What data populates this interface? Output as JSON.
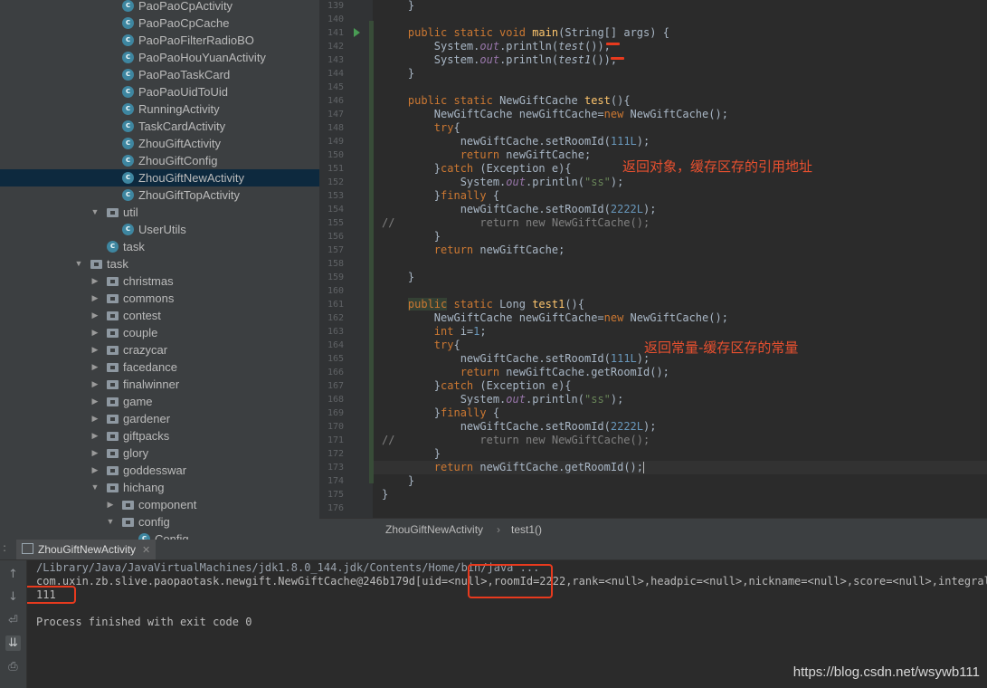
{
  "tree": {
    "items": [
      {
        "label": "PaoPaoCpActivity",
        "icon": "class-icon",
        "indent": 2
      },
      {
        "label": "PaoPaoCpCache",
        "icon": "class-icon",
        "indent": 2
      },
      {
        "label": "PaoPaoFilterRadioBO",
        "icon": "class-icon",
        "indent": 2
      },
      {
        "label": "PaoPaoHouYuanActivity",
        "icon": "class-icon",
        "indent": 2
      },
      {
        "label": "PaoPaoTaskCard",
        "icon": "class-icon",
        "indent": 2
      },
      {
        "label": "PaoPaoUidToUid",
        "icon": "class-icon",
        "indent": 2
      },
      {
        "label": "RunningActivity",
        "icon": "class-icon",
        "indent": 2
      },
      {
        "label": "TaskCardActivity",
        "icon": "class-icon",
        "indent": 2
      },
      {
        "label": "ZhouGiftActivity",
        "icon": "class-icon",
        "indent": 2
      },
      {
        "label": "ZhouGiftConfig",
        "icon": "class-icon",
        "indent": 2
      },
      {
        "label": "ZhouGiftNewActivity",
        "icon": "class-icon",
        "indent": 2,
        "selected": true
      },
      {
        "label": "ZhouGiftTopActivity",
        "icon": "class-icon",
        "indent": 2
      },
      {
        "label": "util",
        "icon": "folder-icon",
        "indent": 1,
        "expanded": true
      },
      {
        "label": "UserUtils",
        "icon": "class-icon",
        "indent": 2
      },
      {
        "label": "task",
        "icon": "class-icon",
        "indent": 1
      },
      {
        "label": "task",
        "icon": "folder-icon",
        "indent": 0,
        "expanded": true
      },
      {
        "label": "christmas",
        "icon": "folder-icon",
        "indent": 1,
        "expanded": false
      },
      {
        "label": "commons",
        "icon": "folder-icon",
        "indent": 1,
        "expanded": false
      },
      {
        "label": "contest",
        "icon": "folder-icon",
        "indent": 1,
        "expanded": false
      },
      {
        "label": "couple",
        "icon": "folder-icon",
        "indent": 1,
        "expanded": false
      },
      {
        "label": "crazycar",
        "icon": "folder-icon",
        "indent": 1,
        "expanded": false
      },
      {
        "label": "facedance",
        "icon": "folder-icon",
        "indent": 1,
        "expanded": false
      },
      {
        "label": "finalwinner",
        "icon": "folder-icon",
        "indent": 1,
        "expanded": false
      },
      {
        "label": "game",
        "icon": "folder-icon",
        "indent": 1,
        "expanded": false
      },
      {
        "label": "gardener",
        "icon": "folder-icon",
        "indent": 1,
        "expanded": false
      },
      {
        "label": "giftpacks",
        "icon": "folder-icon",
        "indent": 1,
        "expanded": false
      },
      {
        "label": "glory",
        "icon": "folder-icon",
        "indent": 1,
        "expanded": false
      },
      {
        "label": "goddesswar",
        "icon": "folder-icon",
        "indent": 1,
        "expanded": false
      },
      {
        "label": "hichang",
        "icon": "folder-icon",
        "indent": 1,
        "expanded": true
      },
      {
        "label": "component",
        "icon": "folder-icon",
        "indent": 2,
        "expanded": false
      },
      {
        "label": "config",
        "icon": "folder-icon",
        "indent": 2,
        "expanded": true
      },
      {
        "label": "Config",
        "icon": "class-icon",
        "indent": 3
      }
    ]
  },
  "editor": {
    "line_numbers": [
      "139",
      "140",
      "141",
      "142",
      "143",
      "144",
      "145",
      "146",
      "147",
      "148",
      "149",
      "150",
      "151",
      "152",
      "153",
      "154",
      "155",
      "156",
      "157",
      "158",
      "159",
      "160",
      "161",
      "162",
      "163",
      "164",
      "165",
      "166",
      "167",
      "168",
      "169",
      "170",
      "171",
      "172",
      "173",
      "174",
      "175",
      "176"
    ],
    "code": [
      [
        {
          "t": "    }"
        }
      ],
      [],
      [
        {
          "t": "    "
        },
        {
          "t": "public static void ",
          "c": "kw"
        },
        {
          "t": "main",
          "c": "fn"
        },
        {
          "t": "(String[] args) {"
        }
      ],
      [
        {
          "t": "        System."
        },
        {
          "t": "out",
          "c": "fld"
        },
        {
          "t": ".println("
        },
        {
          "t": "test",
          "c": "it"
        },
        {
          "t": "());"
        }
      ],
      [
        {
          "t": "        System."
        },
        {
          "t": "out",
          "c": "fld"
        },
        {
          "t": ".println("
        },
        {
          "t": "test1",
          "c": "it"
        },
        {
          "t": "());"
        }
      ],
      [
        {
          "t": "    }"
        }
      ],
      [],
      [
        {
          "t": "    "
        },
        {
          "t": "public static ",
          "c": "kw"
        },
        {
          "t": "NewGiftCache "
        },
        {
          "t": "test",
          "c": "fn"
        },
        {
          "t": "(){"
        }
      ],
      [
        {
          "t": "        NewGiftCache newGiftCache="
        },
        {
          "t": "new ",
          "c": "kw"
        },
        {
          "t": "NewGiftCache();"
        }
      ],
      [
        {
          "t": "        "
        },
        {
          "t": "try",
          "c": "kw"
        },
        {
          "t": "{"
        }
      ],
      [
        {
          "t": "            newGiftCache.setRoomId("
        },
        {
          "t": "111L",
          "c": "num"
        },
        {
          "t": ");"
        }
      ],
      [
        {
          "t": "            "
        },
        {
          "t": "return ",
          "c": "kw"
        },
        {
          "t": "newGiftCache;"
        }
      ],
      [
        {
          "t": "        }"
        },
        {
          "t": "catch ",
          "c": "kw"
        },
        {
          "t": "(Exception e){"
        }
      ],
      [
        {
          "t": "            System."
        },
        {
          "t": "out",
          "c": "fld"
        },
        {
          "t": ".println("
        },
        {
          "t": "\"ss\"",
          "c": "str"
        },
        {
          "t": ");"
        }
      ],
      [
        {
          "t": "        }"
        },
        {
          "t": "finally ",
          "c": "kw"
        },
        {
          "t": "{"
        }
      ],
      [
        {
          "t": "            newGiftCache.setRoomId("
        },
        {
          "t": "2222L",
          "c": "num"
        },
        {
          "t": ");"
        }
      ],
      [
        {
          "t": "//             return new NewGiftCache();",
          "c": "cmt"
        }
      ],
      [
        {
          "t": "        }"
        }
      ],
      [
        {
          "t": "        "
        },
        {
          "t": "return ",
          "c": "kw"
        },
        {
          "t": "newGiftCache;"
        }
      ],
      [],
      [
        {
          "t": "    }"
        }
      ],
      [],
      [
        {
          "t": "    "
        },
        {
          "t": "public",
          "c": "pubhl"
        },
        {
          "t": " static ",
          "c": "kw"
        },
        {
          "t": "Long "
        },
        {
          "t": "test1",
          "c": "fn"
        },
        {
          "t": "(){"
        }
      ],
      [
        {
          "t": "        NewGiftCache newGiftCache="
        },
        {
          "t": "new ",
          "c": "kw"
        },
        {
          "t": "NewGiftCache();"
        }
      ],
      [
        {
          "t": "        "
        },
        {
          "t": "int ",
          "c": "kw"
        },
        {
          "t": "i="
        },
        {
          "t": "1",
          "c": "num"
        },
        {
          "t": ";"
        }
      ],
      [
        {
          "t": "        "
        },
        {
          "t": "try",
          "c": "kw"
        },
        {
          "t": "{"
        }
      ],
      [
        {
          "t": "            newGiftCache.setRoomId("
        },
        {
          "t": "111L",
          "c": "num"
        },
        {
          "t": ");"
        }
      ],
      [
        {
          "t": "            "
        },
        {
          "t": "return ",
          "c": "kw"
        },
        {
          "t": "newGiftCache.getRoomId();"
        }
      ],
      [
        {
          "t": "        }"
        },
        {
          "t": "catch ",
          "c": "kw"
        },
        {
          "t": "(Exception e){"
        }
      ],
      [
        {
          "t": "            System."
        },
        {
          "t": "out",
          "c": "fld"
        },
        {
          "t": ".println("
        },
        {
          "t": "\"ss\"",
          "c": "str"
        },
        {
          "t": ");"
        }
      ],
      [
        {
          "t": "        }"
        },
        {
          "t": "finally ",
          "c": "kw"
        },
        {
          "t": "{"
        }
      ],
      [
        {
          "t": "            newGiftCache.setRoomId("
        },
        {
          "t": "2222L",
          "c": "num"
        },
        {
          "t": ");"
        }
      ],
      [
        {
          "t": "//             return new NewGiftCache();",
          "c": "cmt"
        }
      ],
      [
        {
          "t": "        }"
        }
      ],
      [
        {
          "t": "        "
        },
        {
          "t": "return ",
          "c": "kw"
        },
        {
          "t": "newGiftCache.getRoomId();"
        },
        {
          "caret": true
        }
      ],
      [
        {
          "t": "    }"
        }
      ],
      [
        {
          "t": "}"
        }
      ],
      []
    ],
    "annotation_1": "返回对象，缓存区存的引用地址",
    "annotation_2": "返回常量-缓存区存的常量"
  },
  "breadcrumb": [
    "ZhouGiftNewActivity",
    "test1()"
  ],
  "run_panel": {
    "tab_label": "ZhouGiftNewActivity",
    "lines": [
      "/Library/Java/JavaVirtualMachines/jdk1.8.0_144.jdk/Contents/Home/bin/java ...",
      "com.uxin.zb.slive.paopaotask.newgift.NewGiftCache@246b179d[uid=<null>,roomId=2222,rank=<null>,headpic=<null>,nickname=<null>,score=<null>,integral=<nu",
      "111",
      "",
      "Process finished with exit code 0"
    ]
  },
  "watermark": "https://blog.csdn.net/wsywb111",
  "colors": {
    "annotation": "#e8502f",
    "highlight_box": "#e83a1e",
    "selection": "#0d293e"
  }
}
